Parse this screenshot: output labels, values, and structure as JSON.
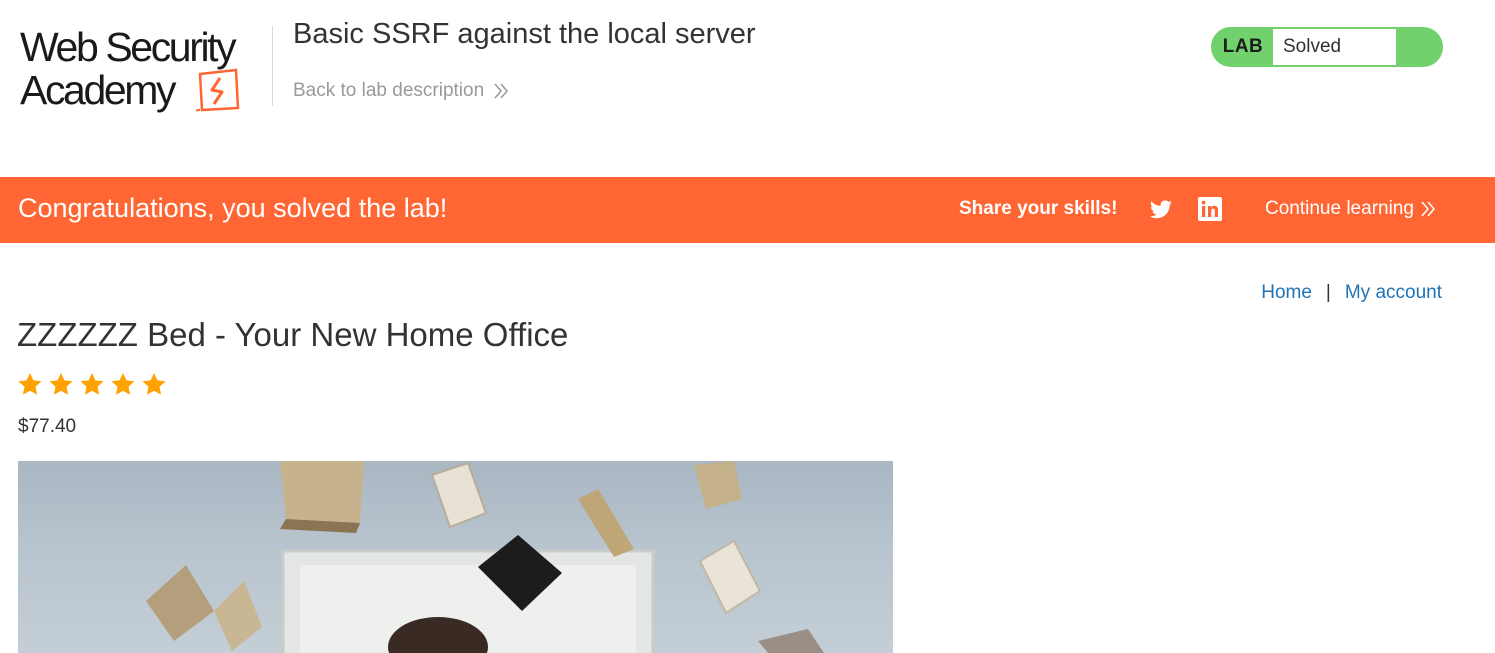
{
  "header": {
    "logo": {
      "line1": "Web Security",
      "line2": "Academy"
    },
    "lab_title": "Basic SSRF against the local server",
    "back_link_label": "Back to lab description",
    "lab_status": {
      "label": "LAB",
      "value": "Solved",
      "color": "#70d16d"
    }
  },
  "banner": {
    "message": "Congratulations, you solved the lab!",
    "share_label": "Share your skills!",
    "continue_label": "Continue learning",
    "color": "#ff6633",
    "icons": [
      "twitter-icon",
      "linkedin-icon"
    ]
  },
  "nav": {
    "home_label": "Home",
    "separator": "|",
    "account_label": "My account",
    "link_color": "#1f73b7"
  },
  "product": {
    "title": "ZZZZZZ Bed - Your New Home Office",
    "rating": 5,
    "rating_max": 5,
    "price": "$77.40",
    "image_icon": "product-image"
  }
}
